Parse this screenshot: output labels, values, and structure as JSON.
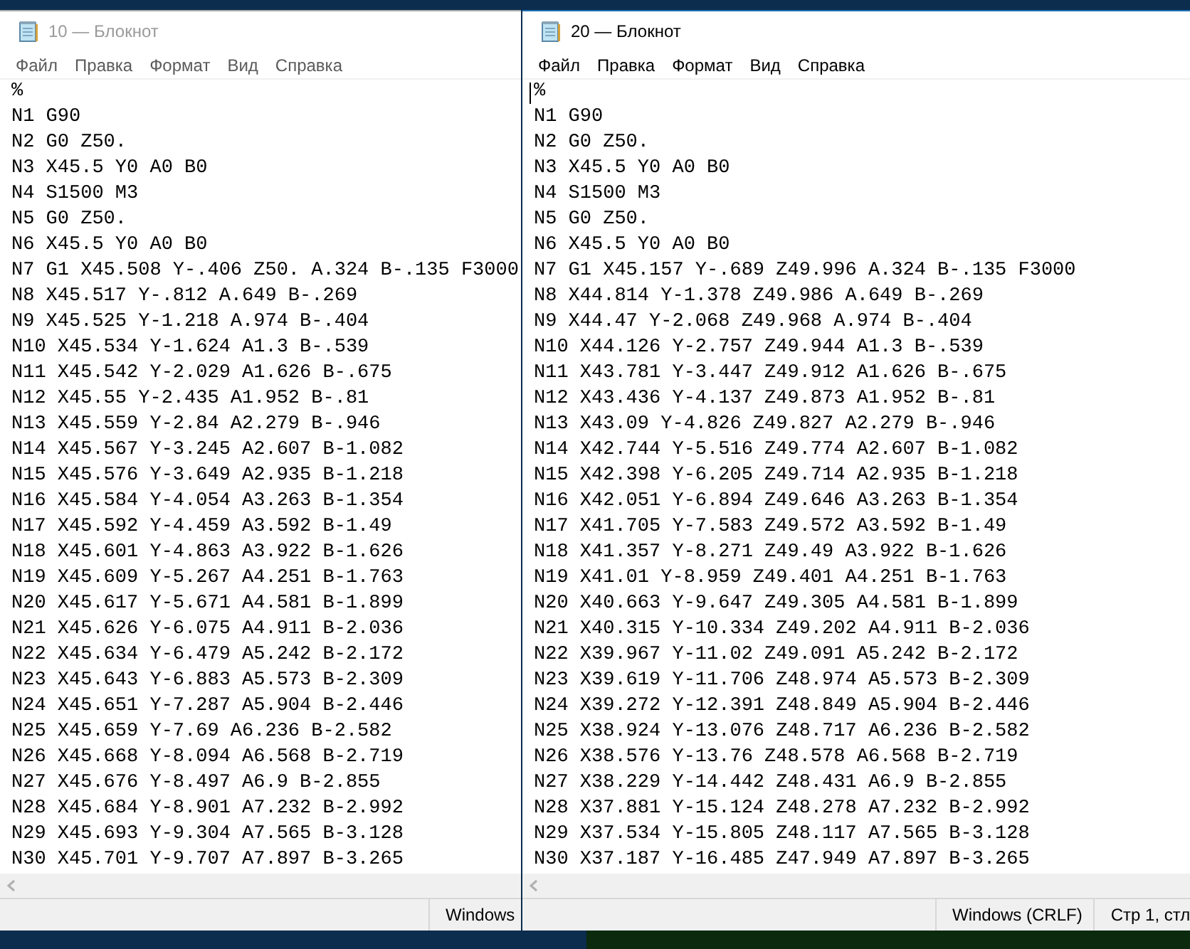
{
  "windows": [
    {
      "title": "10 — Блокнот",
      "active": false,
      "menu": [
        "Файл",
        "Правка",
        "Формат",
        "Вид",
        "Справка"
      ],
      "lines": [
        "%",
        "N1 G90",
        "N2 G0 Z50.",
        "N3 X45.5 Y0 A0 B0",
        "N4 S1500 M3",
        "N5 G0 Z50.",
        "N6 X45.5 Y0 A0 B0",
        "N7 G1 X45.508 Y-.406 Z50. A.324 B-.135 F3000",
        "N8 X45.517 Y-.812 A.649 B-.269",
        "N9 X45.525 Y-1.218 A.974 B-.404",
        "N10 X45.534 Y-1.624 A1.3 B-.539",
        "N11 X45.542 Y-2.029 A1.626 B-.675",
        "N12 X45.55 Y-2.435 A1.952 B-.81",
        "N13 X45.559 Y-2.84 A2.279 B-.946",
        "N14 X45.567 Y-3.245 A2.607 B-1.082",
        "N15 X45.576 Y-3.649 A2.935 B-1.218",
        "N16 X45.584 Y-4.054 A3.263 B-1.354",
        "N17 X45.592 Y-4.459 A3.592 B-1.49",
        "N18 X45.601 Y-4.863 A3.922 B-1.626",
        "N19 X45.609 Y-5.267 A4.251 B-1.763",
        "N20 X45.617 Y-5.671 A4.581 B-1.899",
        "N21 X45.626 Y-6.075 A4.911 B-2.036",
        "N22 X45.634 Y-6.479 A5.242 B-2.172",
        "N23 X45.643 Y-6.883 A5.573 B-2.309",
        "N24 X45.651 Y-7.287 A5.904 B-2.446",
        "N25 X45.659 Y-7.69 A6.236 B-2.582",
        "N26 X45.668 Y-8.094 A6.568 B-2.719",
        "N27 X45.676 Y-8.497 A6.9 B-2.855",
        "N28 X45.684 Y-8.901 A7.232 B-2.992",
        "N29 X45.693 Y-9.304 A7.565 B-3.128",
        "N30 X45.701 Y-9.707 A7.897 B-3.265"
      ],
      "status": [
        "Windows"
      ]
    },
    {
      "title": "20 — Блокнот",
      "active": true,
      "menu": [
        "Файл",
        "Правка",
        "Формат",
        "Вид",
        "Справка"
      ],
      "lines": [
        "%",
        "N1 G90",
        "N2 G0 Z50.",
        "N3 X45.5 Y0 A0 B0",
        "N4 S1500 M3",
        "N5 G0 Z50.",
        "N6 X45.5 Y0 A0 B0",
        "N7 G1 X45.157 Y-.689 Z49.996 A.324 B-.135 F3000",
        "N8 X44.814 Y-1.378 Z49.986 A.649 B-.269",
        "N9 X44.47 Y-2.068 Z49.968 A.974 B-.404",
        "N10 X44.126 Y-2.757 Z49.944 A1.3 B-.539",
        "N11 X43.781 Y-3.447 Z49.912 A1.626 B-.675",
        "N12 X43.436 Y-4.137 Z49.873 A1.952 B-.81",
        "N13 X43.09 Y-4.826 Z49.827 A2.279 B-.946",
        "N14 X42.744 Y-5.516 Z49.774 A2.607 B-1.082",
        "N15 X42.398 Y-6.205 Z49.714 A2.935 B-1.218",
        "N16 X42.051 Y-6.894 Z49.646 A3.263 B-1.354",
        "N17 X41.705 Y-7.583 Z49.572 A3.592 B-1.49",
        "N18 X41.357 Y-8.271 Z49.49 A3.922 B-1.626",
        "N19 X41.01 Y-8.959 Z49.401 A4.251 B-1.763",
        "N20 X40.663 Y-9.647 Z49.305 A4.581 B-1.899",
        "N21 X40.315 Y-10.334 Z49.202 A4.911 B-2.036",
        "N22 X39.967 Y-11.02 Z49.091 A5.242 B-2.172",
        "N23 X39.619 Y-11.706 Z48.974 A5.573 B-2.309",
        "N24 X39.272 Y-12.391 Z48.849 A5.904 B-2.446",
        "N25 X38.924 Y-13.076 Z48.717 A6.236 B-2.582",
        "N26 X38.576 Y-13.76 Z48.578 A6.568 B-2.719",
        "N27 X38.229 Y-14.442 Z48.431 A6.9 B-2.855",
        "N28 X37.881 Y-15.124 Z48.278 A7.232 B-2.992",
        "N29 X37.534 Y-15.805 Z48.117 A7.565 B-3.128",
        "N30 X37.187 Y-16.485 Z47.949 A7.897 B-3.265"
      ],
      "status": [
        "Windows (CRLF)",
        "Стр 1, стл"
      ]
    }
  ]
}
